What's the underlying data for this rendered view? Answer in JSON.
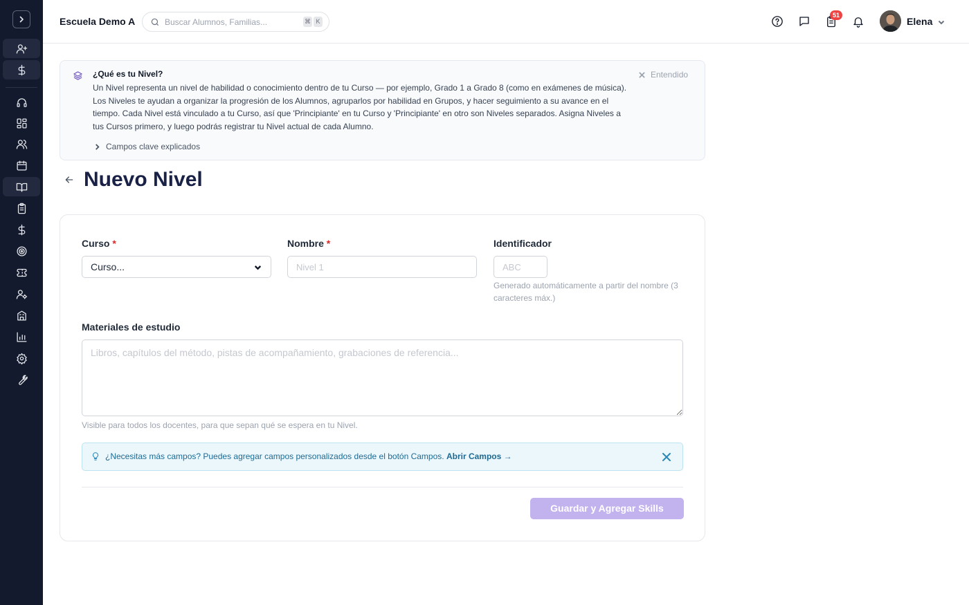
{
  "header": {
    "school_name": "Escuela Demo A",
    "search_placeholder": "Buscar Alumnos, Familias...",
    "shortcut_keys": [
      "⌘",
      "K"
    ],
    "notification_count": "51",
    "user_name": "Elena"
  },
  "banner": {
    "title": "¿Qué es tu Nivel?",
    "body": "Un Nivel representa un nivel de habilidad o conocimiento dentro de tu Curso — por ejemplo, Grado 1 a Grado 8 (como en exámenes de música). Los Niveles te ayudan a organizar la progresión de los Alumnos, agruparlos por habilidad en Grupos, y hacer seguimiento a su avance en el tiempo. Cada Nivel está vinculado a tu Curso, así que 'Principiante' en tu Curso y 'Principiante' en otro son Niveles separados. Asigna Niveles a tus Cursos primero, y luego podrás registrar tu Nivel actual de cada Alumno.",
    "dismiss_label": "Entendido",
    "expand_label": "Campos clave explicados"
  },
  "page": {
    "title": "Nuevo Nivel"
  },
  "form": {
    "curso_label": "Curso",
    "curso_value": "Curso...",
    "nombre_label": "Nombre",
    "nombre_placeholder": "Nivel 1",
    "identificador_label": "Identificador",
    "identificador_placeholder": "ABC",
    "identificador_hint": "Generado automáticamente a partir del nombre (3 caracteres máx.)",
    "required_mark": "*",
    "materiales_label": "Materiales de estudio",
    "materiales_placeholder": "Libros, capítulos del método, pistas de acompañamiento, grabaciones de referencia...",
    "materiales_hint": "Visible para todos los docentes, para que sepan qué se espera en tu Nivel.",
    "tip_text": "¿Necesitas más campos? Puedes agregar campos personalizados desde el botón Campos.",
    "tip_link": "Abrir Campos →",
    "submit_label": "Guardar y Agregar Skills"
  },
  "colors": {
    "sidebar_bg": "#141a2e",
    "title": "#1a2147",
    "accent": "#6d4fc4",
    "submit_disabled": "#c2b2ee",
    "badge": "#ef4444",
    "tip_bg": "#ecf7fc"
  }
}
